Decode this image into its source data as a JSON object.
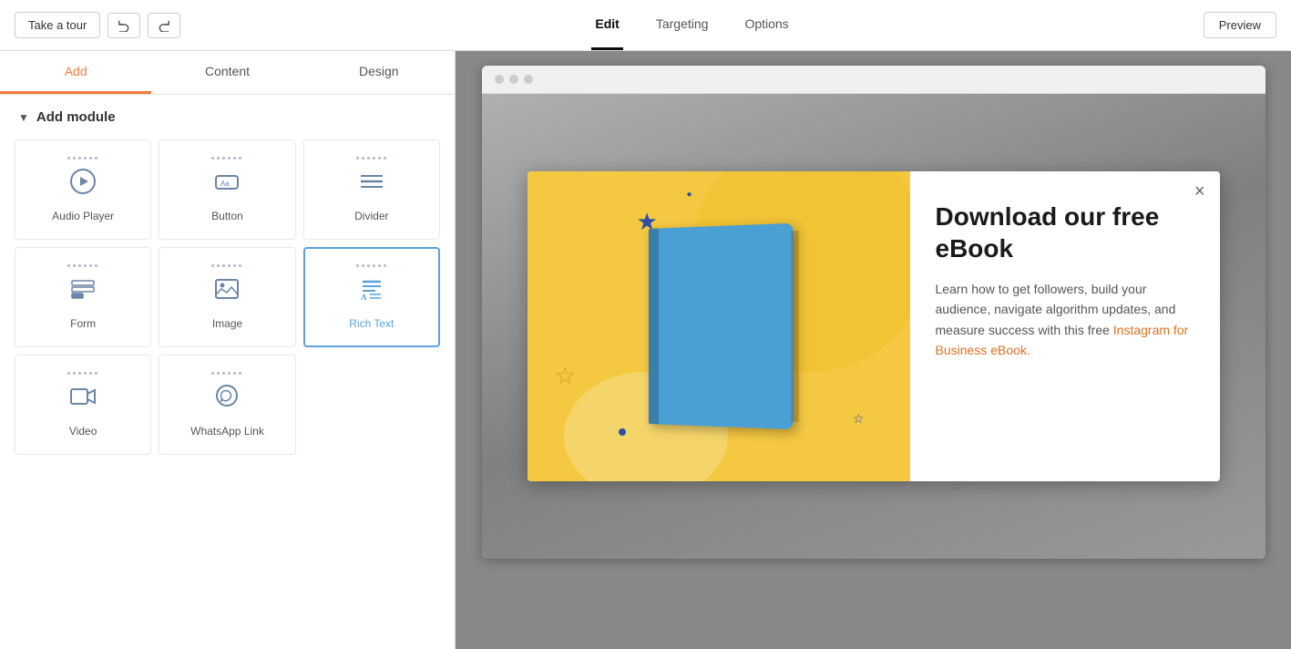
{
  "topbar": {
    "take_tour_label": "Take a tour",
    "undo_label": "↩",
    "redo_label": "↪",
    "tabs": [
      {
        "id": "edit",
        "label": "Edit",
        "active": true
      },
      {
        "id": "targeting",
        "label": "Targeting",
        "active": false
      },
      {
        "id": "options",
        "label": "Options",
        "active": false
      }
    ],
    "preview_label": "Preview"
  },
  "left_panel": {
    "tabs": [
      {
        "id": "add",
        "label": "Add",
        "active": true
      },
      {
        "id": "content",
        "label": "Content",
        "active": false
      },
      {
        "id": "design",
        "label": "Design",
        "active": false
      }
    ],
    "add_module_header": "Add module",
    "modules": [
      {
        "id": "audio-player",
        "label": "Audio Player",
        "icon": "audio"
      },
      {
        "id": "button",
        "label": "Button",
        "icon": "button"
      },
      {
        "id": "divider",
        "label": "Divider",
        "icon": "divider"
      },
      {
        "id": "form",
        "label": "Form",
        "icon": "form"
      },
      {
        "id": "image",
        "label": "Image",
        "icon": "image"
      },
      {
        "id": "rich-text",
        "label": "Rich Text",
        "icon": "richtext",
        "active": true
      },
      {
        "id": "video",
        "label": "Video",
        "icon": "video"
      },
      {
        "id": "whatsapp-link",
        "label": "WhatsApp Link",
        "icon": "whatsapp"
      }
    ]
  },
  "popup": {
    "title": "Download our free eBook",
    "description_part1": "Learn how to get followers, build your audience, navigate algorithm updates, and measure success with this free Instagram for Business eBook.",
    "close_label": "×"
  }
}
